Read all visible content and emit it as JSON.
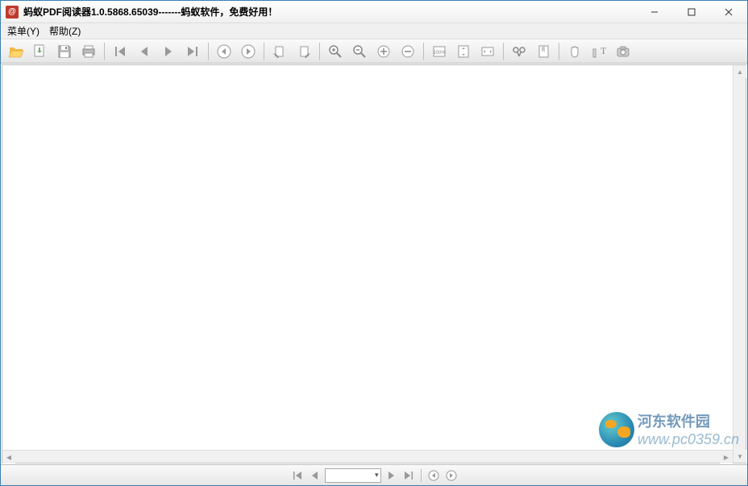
{
  "window": {
    "title": "蚂蚁PDF阅读器1.0.5868.65039-------蚂蚁软件，免费好用！",
    "app_icon_char": "@"
  },
  "menu": {
    "items": [
      "菜单(Y)",
      "帮助(Z)"
    ]
  },
  "toolbar_icons": {
    "open": "open-folder-icon",
    "save_to": "save-page-icon",
    "save": "save-icon",
    "print": "print-icon",
    "first": "first-page-icon",
    "prev": "prev-page-icon",
    "next": "next-page-icon",
    "last": "last-page-icon",
    "back": "nav-back-icon",
    "forward": "nav-forward-icon",
    "rotate_ccw": "rotate-ccw-icon",
    "rotate_cw": "rotate-cw-icon",
    "zoom_in": "zoom-in-icon",
    "zoom_out": "zoom-out-icon",
    "enlarge": "enlarge-icon",
    "shrink": "shrink-icon",
    "actual": "actual-size-icon",
    "fit_page": "fit-page-icon",
    "fit_width": "fit-width-icon",
    "find": "find-icon",
    "bookmark": "bookmark-icon",
    "hand": "hand-tool-icon",
    "text_select": "text-select-icon",
    "snapshot": "snapshot-icon"
  },
  "actual_size_label": "100%",
  "watermark": {
    "brand": "河东软件园",
    "url": "www.pc0359.cn"
  }
}
